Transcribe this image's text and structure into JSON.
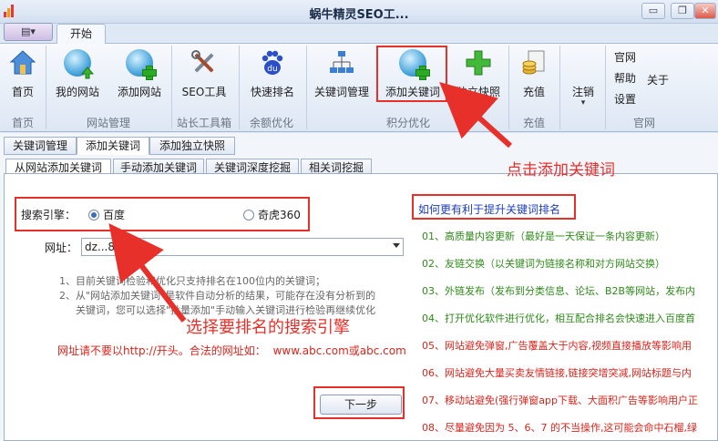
{
  "window": {
    "title": "蜗牛精灵SEO工...",
    "minimize": "▭",
    "close": "✕"
  },
  "ribbon": {
    "tab": "开始",
    "buttons": {
      "home": "首页",
      "my_sites": "我的网站",
      "add_site": "添加网站",
      "seo_tool": "SEO工具",
      "quick_rank": "快速排名",
      "kw_manage": "关键词管理",
      "add_kw": "添加关键词",
      "snapshot": "独立快照",
      "recharge": "充值",
      "logout": "注销"
    },
    "mini": {
      "official": "官网",
      "help": "帮助",
      "settings": "设置",
      "about": "关于"
    },
    "groups": {
      "home": "首页",
      "site_manage": "网站管理",
      "webmaster": "站长工具箱",
      "balance": "余额优化",
      "points": "积分优化",
      "recharge": "充值",
      "official": "官网"
    }
  },
  "tabs1": [
    "关键词管理",
    "添加关键词",
    "添加独立快照"
  ],
  "tabs2": [
    "从网站添加关键词",
    "手动添加关键词",
    "关键词深度挖掘",
    "相关词挖掘"
  ],
  "form": {
    "engine_label": "搜索引擎：",
    "baidu": "百度",
    "qihoo": "奇虎360",
    "url_label": "网址：",
    "url_value": "dz...8.com",
    "note1": "1、目前关键词检验和优化只支持排名在100位内的关键词；",
    "note2": "2、从\"网站添加关键词\"是软件自动分析的结果，可能存在没有分析到的",
    "note3": "关键词，您可以选择\"批量添加\"手动输入关键词进行检验再继续优化",
    "url_warning": "网址请不要以http://开头。合法的网址如：",
    "url_example": "www.abc.com或abc.com",
    "next": "下一步"
  },
  "annotations": {
    "click_add": "点击添加关键词",
    "choose_engine": "选择要排名的搜索引擎"
  },
  "tips": {
    "title": "如何更有利于提升关键词排名",
    "items": [
      "01、高质量内容更新（最好是一天保证一条内容更新）",
      "02、友链交换（以关键词为链接名称和对方网站交换）",
      "03、外链发布（发布到分类信息、论坛、B2B等网站，发布内",
      "04、打开优化软件进行优化，相互配合排名会快速进入百度首",
      "05、网站避免弹窗,广告覆盖大于内容,视频直接播放等影响用",
      "06、网站避免大量买卖友情链接,链接突增突减,网站标题与内",
      "07、移动站避免(强行弹窗app下载、大面积广告等影响用户正",
      "08、尽量避免因为 5、6、7 的不当操作,这可能会命中石榴,绿"
    ]
  },
  "colors": {
    "accent_red": "#e8302a",
    "tip_green": "#2f8a1a",
    "tip_red": "#d9251c",
    "title_blue": "#1d3dbd"
  }
}
